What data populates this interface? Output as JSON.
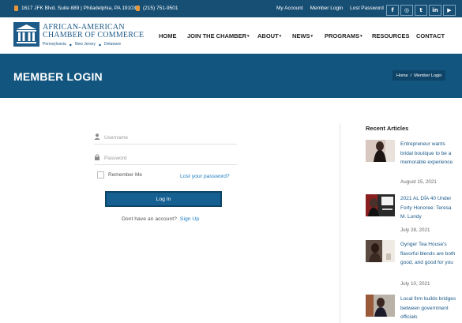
{
  "topbar": {
    "address": "1617 JFK Blvd. Suite 889 | Philadelphia, PA 19103",
    "phone": "(215) 751-9501",
    "links": [
      "My Account",
      "Member Login",
      "Lost Password"
    ],
    "social": [
      {
        "icon": "facebook-icon",
        "glyph": "f"
      },
      {
        "icon": "instagram-icon",
        "glyph": "◎"
      },
      {
        "icon": "twitter-icon",
        "glyph": "t"
      },
      {
        "icon": "linkedin-icon",
        "glyph": "in"
      },
      {
        "icon": "youtube-icon",
        "glyph": "▶"
      }
    ]
  },
  "logo": {
    "line1": "AFRICAN-AMERICAN",
    "line2": "CHAMBER OF COMMERCE",
    "states": [
      "Pennsylvania",
      "New Jersey",
      "Delaware"
    ]
  },
  "nav": [
    {
      "label": "HOME",
      "caret": false
    },
    {
      "label": "JOIN THE CHAMBER",
      "caret": true
    },
    {
      "label": "ABOUT",
      "caret": true
    },
    {
      "label": "NEWS",
      "caret": true
    },
    {
      "label": "PROGRAMS",
      "caret": true
    },
    {
      "label": "RESOURCES",
      "caret": false
    },
    {
      "label": "CONTACT",
      "caret": false
    }
  ],
  "page_title": "MEMBER LOGIN",
  "breadcrumb": {
    "home": "Home",
    "sep": "/",
    "current": "Member Login"
  },
  "form": {
    "username_placeholder": "Username",
    "password_placeholder": "Password",
    "remember_label": "Remember Me",
    "lost_password": "Lost your password?",
    "login_button": "Log In",
    "no_account": "Dont have an account?",
    "signup": "Sign Up"
  },
  "sidebar": {
    "heading": "Recent Articles",
    "articles": [
      {
        "title": "Entrepreneur wants bridal boutique to be a memorable experience",
        "date": "August 15, 2021"
      },
      {
        "title": "2021 AL DÍA 40 Under Forty Honoree: Teresa M. Lundy",
        "date": "July 28, 2021"
      },
      {
        "title": "Gynger Tea House's flavorful blends are both good, and good for you",
        "date": "July 10, 2021"
      },
      {
        "title": "Local firm builds bridges between government officials",
        "date": ""
      }
    ]
  },
  "colors": {
    "topbar": "#174f74",
    "band": "#12557f",
    "link": "#1b7bc0",
    "button": "#155f91"
  }
}
